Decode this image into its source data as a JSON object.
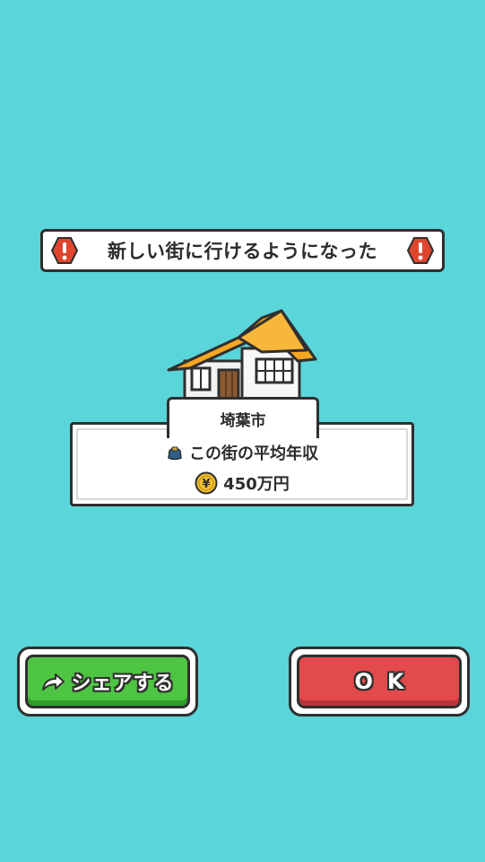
{
  "banner": {
    "title": "新しい街に行けるようになった",
    "icon_left": "exclamation-hexagon-icon",
    "icon_right": "exclamation-hexagon-icon"
  },
  "city": {
    "name": "埼葉市",
    "illustration": "house-icon"
  },
  "info": {
    "income_label": "この街の平均年収",
    "income_icon": "wallet-icon",
    "income_value": "450万円",
    "value_icon": "yen-coin-icon"
  },
  "buttons": {
    "share_label": "シェアする",
    "share_icon": "share-arrow-icon",
    "ok_label": "OK"
  },
  "colors": {
    "background": "#5ad5d9",
    "share_button": "#4ec443",
    "ok_button": "#e34a4b",
    "warning": "#e0452f",
    "roof": "#f6a622"
  }
}
